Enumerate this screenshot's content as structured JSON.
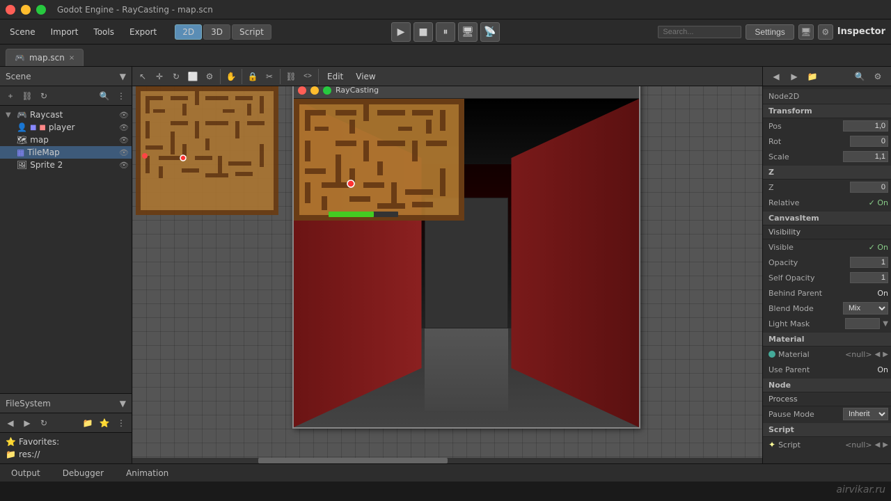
{
  "titlebar": {
    "title": "Godot Engine - RayCasting - map.scn"
  },
  "menubar": {
    "items": [
      "Scene",
      "Import",
      "Tools",
      "Export"
    ]
  },
  "toolbar_left": {
    "mode_2d": "2D",
    "mode_3d": "3D",
    "mode_script": "Script"
  },
  "play_controls": {
    "play": "▶",
    "stop": "■",
    "pause": "⏸",
    "deploy": "📱",
    "remote": "📡"
  },
  "top_right": {
    "settings": "Settings",
    "inspector_label": "Inspector"
  },
  "tabs": {
    "scene_tab": "map.scn",
    "close": "×"
  },
  "left_panel": {
    "header": "Scene",
    "tree_items": [
      {
        "id": "raycast",
        "label": "Raycast",
        "icon": "🎮",
        "indent": 0,
        "arrow": "▼"
      },
      {
        "id": "player",
        "label": "player",
        "icon": "👤",
        "indent": 1,
        "arrow": ""
      },
      {
        "id": "map",
        "label": "map",
        "icon": "🗺",
        "indent": 1,
        "arrow": ""
      },
      {
        "id": "tilemap",
        "label": "TileMap",
        "icon": "▦",
        "indent": 1,
        "arrow": ""
      },
      {
        "id": "sprite2",
        "label": "Sprite 2",
        "icon": "🖼",
        "indent": 1,
        "arrow": ""
      }
    ]
  },
  "filesystem": {
    "header": "FileSystem",
    "items": [
      {
        "label": "Favorites:",
        "icon": "⭐",
        "indent": 0
      },
      {
        "label": "res://",
        "icon": "📁",
        "indent": 0
      }
    ]
  },
  "viewport_tools": [
    "↖",
    "+",
    "↻",
    "⬜",
    "⚙",
    "✋",
    "🔒",
    "✂",
    "⛓",
    "<>",
    "Edit",
    "View"
  ],
  "game_preview": {
    "title": "RayCasting",
    "health_bar_pct": 65
  },
  "inspector": {
    "title": "Inspector",
    "node_type": "Node2D",
    "sections": [
      {
        "name": "Transform",
        "rows": [
          {
            "label": "Pos",
            "value": "1,0"
          },
          {
            "label": "Rot",
            "value": "0"
          },
          {
            "label": "Scale",
            "value": "1,1"
          }
        ]
      },
      {
        "name": "Z",
        "rows": [
          {
            "label": "Z",
            "value": "0"
          },
          {
            "label": "Relative",
            "check": "On"
          }
        ]
      },
      {
        "name": "CanvasItem",
        "rows": []
      },
      {
        "name": "Visibility",
        "rows": [
          {
            "label": "Visible",
            "check": "On"
          },
          {
            "label": "Opacity",
            "value": "1"
          },
          {
            "label": "Self Opacity",
            "value": "1"
          },
          {
            "label": "Behind Parent",
            "value": "On"
          },
          {
            "label": "Blend Mode",
            "dropdown": "Mix"
          },
          {
            "label": "Light Mask",
            "value": ""
          }
        ]
      },
      {
        "name": "Material",
        "rows": [
          {
            "label": "Material",
            "null_val": "<null>"
          },
          {
            "label": "Use Parent",
            "value": "On"
          }
        ]
      },
      {
        "name": "Node",
        "rows": []
      },
      {
        "name": "Process",
        "rows": [
          {
            "label": "Pause Mode",
            "dropdown": "Inherit"
          }
        ]
      },
      {
        "name": "Script",
        "rows": [
          {
            "label": "Script",
            "null_val": "<null>"
          }
        ]
      }
    ]
  },
  "bottom_tabs": [
    "Output",
    "Debugger",
    "Animation"
  ],
  "watermark": "airvikar.ru"
}
